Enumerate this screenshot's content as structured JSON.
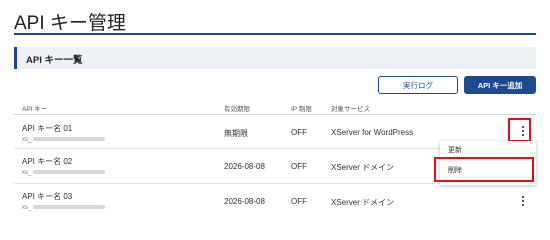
{
  "page": {
    "title": "API キー管理"
  },
  "section": {
    "title": "API キー一覧"
  },
  "toolbar": {
    "log_label": "実行ログ",
    "add_label": "API キー追加"
  },
  "table": {
    "headers": [
      "API キー",
      "有効期限",
      "IP 制限",
      "対象サービス"
    ],
    "rows": [
      {
        "name": "API キー名 01",
        "id_prefix": "xs_",
        "expiry": "無期限",
        "ip": "OFF",
        "service": "XServer for WordPress"
      },
      {
        "name": "API キー名 02",
        "id_prefix": "xs_",
        "expiry": "2026-08-08",
        "ip": "OFF",
        "service": "XServer ドメイン"
      },
      {
        "name": "API キー名 03",
        "id_prefix": "xs_",
        "expiry": "2026-08-08",
        "ip": "OFF",
        "service": "XServer ドメイン"
      }
    ]
  },
  "menu": {
    "items": [
      "更新",
      "削除"
    ]
  },
  "colors": {
    "accent": "#1e4a8c",
    "highlight": "#d6141e",
    "section_bg": "#eef2f7"
  }
}
